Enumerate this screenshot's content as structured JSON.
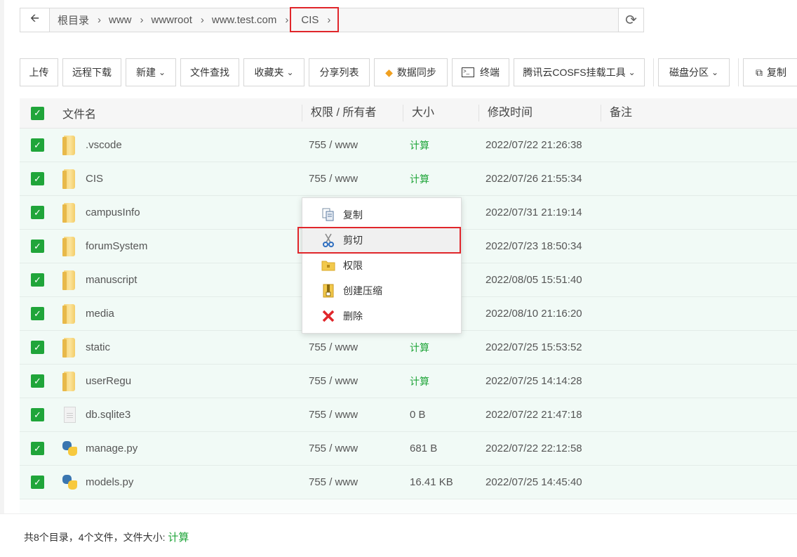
{
  "breadcrumb": {
    "items": [
      "根目录",
      "www",
      "wwwroot",
      "www.test.com"
    ],
    "current": "CIS"
  },
  "toolbar": {
    "upload": "上传",
    "remote_download": "远程下载",
    "new": "新建",
    "file_search": "文件查找",
    "favorites": "收藏夹",
    "share_list": "分享列表",
    "data_sync": "数据同步",
    "terminal": "终端",
    "cosfs_tool": "腾讯云COSFS挂载工具",
    "disk_partition": "磁盘分区",
    "copy": "复制"
  },
  "table": {
    "headers": {
      "name": "文件名",
      "perm": "权限 / 所有者",
      "size": "大小",
      "time": "修改时间",
      "note": "备注"
    },
    "rows": [
      {
        "name": ".vscode",
        "type": "folder",
        "perm": "755 / www",
        "size": "计算",
        "time": "2022/07/22 21:26:38"
      },
      {
        "name": "CIS",
        "type": "folder",
        "perm": "755 / www",
        "size": "计算",
        "time": "2022/07/26 21:55:34"
      },
      {
        "name": "campusInfo",
        "type": "folder",
        "perm": "",
        "size": "",
        "time": "2022/07/31 21:19:14"
      },
      {
        "name": "forumSystem",
        "type": "folder",
        "perm": "",
        "size": "",
        "time": "2022/07/23 18:50:34"
      },
      {
        "name": "manuscript",
        "type": "folder",
        "perm": "",
        "size": "",
        "time": "2022/08/05 15:51:40"
      },
      {
        "name": "media",
        "type": "folder",
        "perm": "",
        "size": "",
        "time": "2022/08/10 21:16:20"
      },
      {
        "name": "static",
        "type": "folder",
        "perm": "755 / www",
        "size": "计算",
        "time": "2022/07/25 15:53:52"
      },
      {
        "name": "userRegu",
        "type": "folder",
        "perm": "755 / www",
        "size": "计算",
        "time": "2022/07/25 14:14:28"
      },
      {
        "name": "db.sqlite3",
        "type": "file",
        "perm": "755 / www",
        "size": "0 B",
        "time": "2022/07/22 21:47:18"
      },
      {
        "name": "manage.py",
        "type": "python",
        "perm": "755 / www",
        "size": "681 B",
        "time": "2022/07/22 22:12:58"
      },
      {
        "name": "models.py",
        "type": "python",
        "perm": "755 / www",
        "size": "16.41 KB",
        "time": "2022/07/25 14:45:40"
      }
    ]
  },
  "context_menu": {
    "items": [
      {
        "label": "复制",
        "icon": "copy-icon"
      },
      {
        "label": "剪切",
        "icon": "scissors-icon"
      },
      {
        "label": "权限",
        "icon": "permission-folder-icon"
      },
      {
        "label": "创建压缩",
        "icon": "zip-icon"
      },
      {
        "label": "删除",
        "icon": "delete-x-icon"
      }
    ]
  },
  "footer": {
    "summary": "共8个目录，4个文件，文件大小:",
    "calc": "计算"
  },
  "colors": {
    "accent": "#20a53a",
    "highlight": "#e0262b"
  }
}
